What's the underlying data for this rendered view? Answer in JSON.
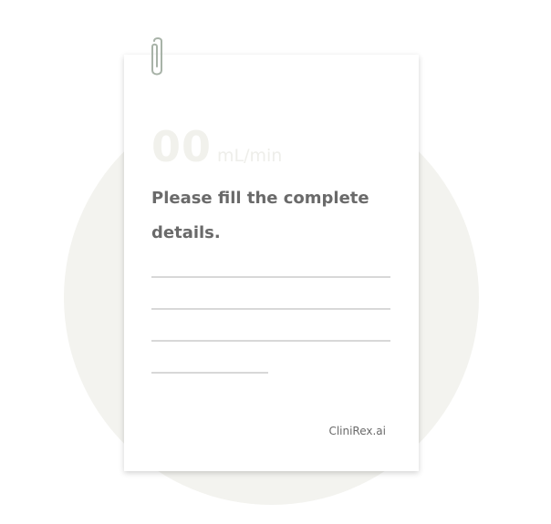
{
  "result": {
    "value": "00",
    "unit": "mL/min"
  },
  "message": "Please fill the complete details.",
  "footer": {
    "brand": "CliniRex.ai"
  },
  "icons": {
    "clip": "paperclip-icon"
  },
  "colors": {
    "background_circle": "#f3f3ef",
    "card": "#ffffff",
    "placeholder_value": "#f1f1ec",
    "text": "#6a6a6a",
    "line": "#d8d8d8",
    "clip": "#a8b3a8"
  }
}
